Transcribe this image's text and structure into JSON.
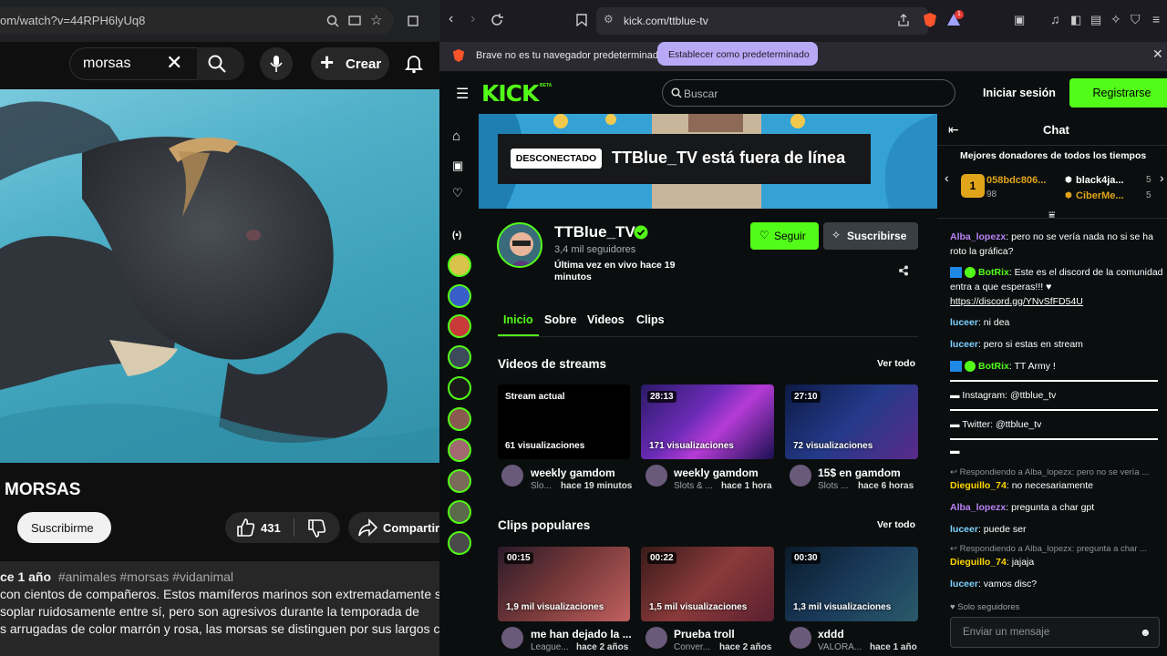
{
  "left_window": {
    "url": "om/watch?v=44RPH6lyUq8",
    "search_query": "morsas",
    "create_label": "Crear",
    "video_title": "MORSAS",
    "subscribe_label": "Suscribirme",
    "likes": "431",
    "share_label": "Compartir",
    "description": {
      "date": "ce 1 año",
      "tags": "#animales #morsas #vidanimal",
      "line1": "con cientos de compañeros. Estos mamíferos marinos son extremadamente soc",
      "line2": "soplar ruidosamente entre sí, pero son agresivos durante la temporada de",
      "line3": "s arrugadas de color marrón y rosa, las morsas se distinguen por sus largos col"
    }
  },
  "right_window": {
    "url": "kick.com/ttblue-tv",
    "notification_count": "1",
    "default_browser_text": "Brave no es tu navegador predeterminado",
    "set_default_label": "Establecer como predeterminado",
    "logo": "KICK",
    "logo_beta": "BETA",
    "search_placeholder": "Buscar",
    "login_label": "Iniciar sesión",
    "register_label": "Registrarse",
    "banner": {
      "status_badge": "DESCONECTADO",
      "offline_text": "TTBlue_TV está fuera de línea"
    },
    "channel": {
      "name": "TTBlue_TV",
      "followers": "3,4 mil seguidores",
      "last_live": "Última vez en vivo hace 19 minutos",
      "follow_label": "Seguir",
      "subscribe_label": "Suscribirse"
    },
    "tabs": [
      "Inicio",
      "Sobre",
      "Videos",
      "Clips"
    ],
    "streams_section": {
      "title": "Videos de streams",
      "see_all": "Ver todo",
      "items": [
        {
          "badge": "Stream actual",
          "views": "61 visualizaciones",
          "title": "weekly gamdom",
          "category": "Slo...",
          "ago": "hace 19 minutos"
        },
        {
          "badge": "28:13",
          "views": "171 visualizaciones",
          "title": "weekly gamdom",
          "category": "Slots & ...",
          "ago": "hace 1 hora"
        },
        {
          "badge": "27:10",
          "views": "72 visualizaciones",
          "title": "15$ en gamdom",
          "category": "Slots ...",
          "ago": "hace 6 horas"
        }
      ]
    },
    "clips_section": {
      "title": "Clips populares",
      "see_all": "Ver todo",
      "items": [
        {
          "badge": "00:15",
          "views": "1,9 mil visualizaciones",
          "title": "me han dejado la ...",
          "category": "League...",
          "ago": "hace 2 años"
        },
        {
          "badge": "00:22",
          "views": "1,5 mil visualizaciones",
          "title": "Prueba troll",
          "category": "Conver...",
          "ago": "hace 2 años"
        },
        {
          "badge": "00:30",
          "views": "1,3 mil visualizaciones",
          "title": "xddd",
          "category": "VALORA...",
          "ago": "hace 1 año"
        }
      ]
    },
    "chat": {
      "title": "Chat",
      "donors_title": "Mejores donadores de todos los tiempos",
      "donor1_name": "058bdc806...",
      "donor1_amount": "98",
      "donor2_name": "black4ja...",
      "donor2_amount": "5",
      "donor3_name": "CiberMe...",
      "donor3_amount": "5",
      "rank": "1",
      "messages": [
        {
          "user": "Alba_lopezx",
          "text": ": pero no se vería nada no si se ha roto la gráfica?"
        },
        {
          "user": "BotRix",
          "text": ": Este es el discord de la comunidad entra a que esperas!!! ♥",
          "link": "https://discord.gg/YNvSfFD54U"
        },
        {
          "user": "luceer",
          "text": ": ni dea"
        },
        {
          "user": "luceer",
          "text": ": pero si estas en stream"
        },
        {
          "user": "BotRix",
          "text": ": TT Army !"
        },
        {
          "user": "",
          "text": "▬ Instagram: @ttblue_tv"
        },
        {
          "user": "",
          "text": "▬ Twitter: @ttblue_tv"
        },
        {
          "user": "",
          "text": "▬"
        },
        {
          "reply": "Respondiendo a Alba_lopezx: pero no se vería ..."
        },
        {
          "user": "Dieguillo_74",
          "text": ": no necesariamente"
        },
        {
          "user": "Alba_lopezx",
          "text": ": pregunta a char gpt"
        },
        {
          "user": "luceer",
          "text": ": puede ser"
        },
        {
          "reply": "Respondiendo a Alba_lopezx: pregunta a char ..."
        },
        {
          "user": "Dieguillo_74",
          "text": ": jajaja"
        },
        {
          "user": "luceer",
          "text": ": vamos disc?"
        }
      ],
      "followers_only": "Solo seguidores",
      "input_placeholder": "Enviar un mensaje"
    }
  },
  "colors": {
    "kick_green": "#53fc18",
    "purple_button": "#b8a9f7"
  }
}
